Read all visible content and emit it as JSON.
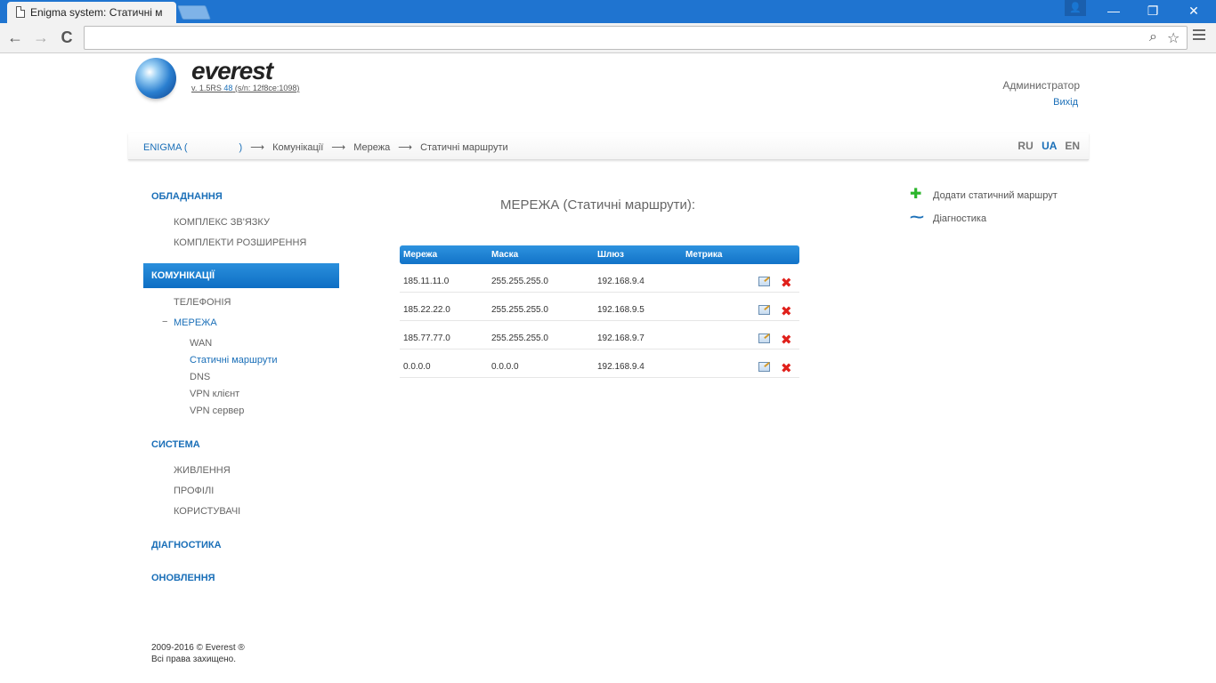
{
  "browser": {
    "tab_title": "Enigma system: Статичні м",
    "user_glyph": "👤",
    "minimize": "—",
    "restore": "❐",
    "close": "✕",
    "back": "←",
    "forward": "→",
    "reload": "C",
    "url": ""
  },
  "header": {
    "brand": "everest",
    "version_prefix": "v. 1.5RS ",
    "version_num": "48",
    "version_suffix": " (s/n: 12f8ce:1098)",
    "user": "Администратор",
    "logout": "Вихід"
  },
  "breadcrumb": {
    "root": "ENIGMA (",
    "root_close": ")",
    "arrow": "⟶",
    "items": [
      "Комунікації",
      "Мережа",
      "Статичні маршрути"
    ]
  },
  "languages": [
    "RU",
    "UA",
    "EN"
  ],
  "active_language": "UA",
  "sidebar": {
    "hardware": "ОБЛАДНАННЯ",
    "hardware_items": [
      "КОМПЛЕКС ЗВ'ЯЗКУ",
      "КОМПЛЕКТИ РОЗШИРЕННЯ"
    ],
    "communications": "КОМУНІКАЦІЇ",
    "comm_items": [
      "ТЕЛЕФОНІЯ",
      "МЕРЕЖА"
    ],
    "network_minus": "−",
    "network_items": [
      "WAN",
      "Статичні маршрути",
      "DNS",
      "VPN клієнт",
      "VPN сервер"
    ],
    "system": "СИСТЕМА",
    "system_items": [
      "ЖИВЛЕННЯ",
      "ПРОФІЛІ",
      "КОРИСТУВАЧІ"
    ],
    "diagnostics": "ДІАГНОСТИКА",
    "updates": "ОНОВЛЕННЯ"
  },
  "footer": {
    "line1": "2009-2016 © Everest ®",
    "line2": "Всі права захищено."
  },
  "main": {
    "heading": "МЕРЕЖА (Статичні маршрути):",
    "columns": [
      "Мережа",
      "Маска",
      "Шлюз",
      "Метрика"
    ],
    "rows": [
      {
        "network": "185.11.11.0",
        "mask": "255.255.255.0",
        "gateway": "192.168.9.4",
        "metric": ""
      },
      {
        "network": "185.22.22.0",
        "mask": "255.255.255.0",
        "gateway": "192.168.9.5",
        "metric": ""
      },
      {
        "network": "185.77.77.0",
        "mask": "255.255.255.0",
        "gateway": "192.168.9.7",
        "metric": ""
      },
      {
        "network": "0.0.0.0",
        "mask": "0.0.0.0",
        "gateway": "192.168.9.4",
        "metric": ""
      }
    ],
    "delete_glyph": "✖"
  },
  "actions": {
    "add_route": "Додати статичний маршрут",
    "add_glyph": "✚",
    "diagnostics": "Діагностика",
    "diag_glyph": "⁓",
    "add_color": "#2bb52b",
    "diag_color": "#1a6fb8"
  }
}
